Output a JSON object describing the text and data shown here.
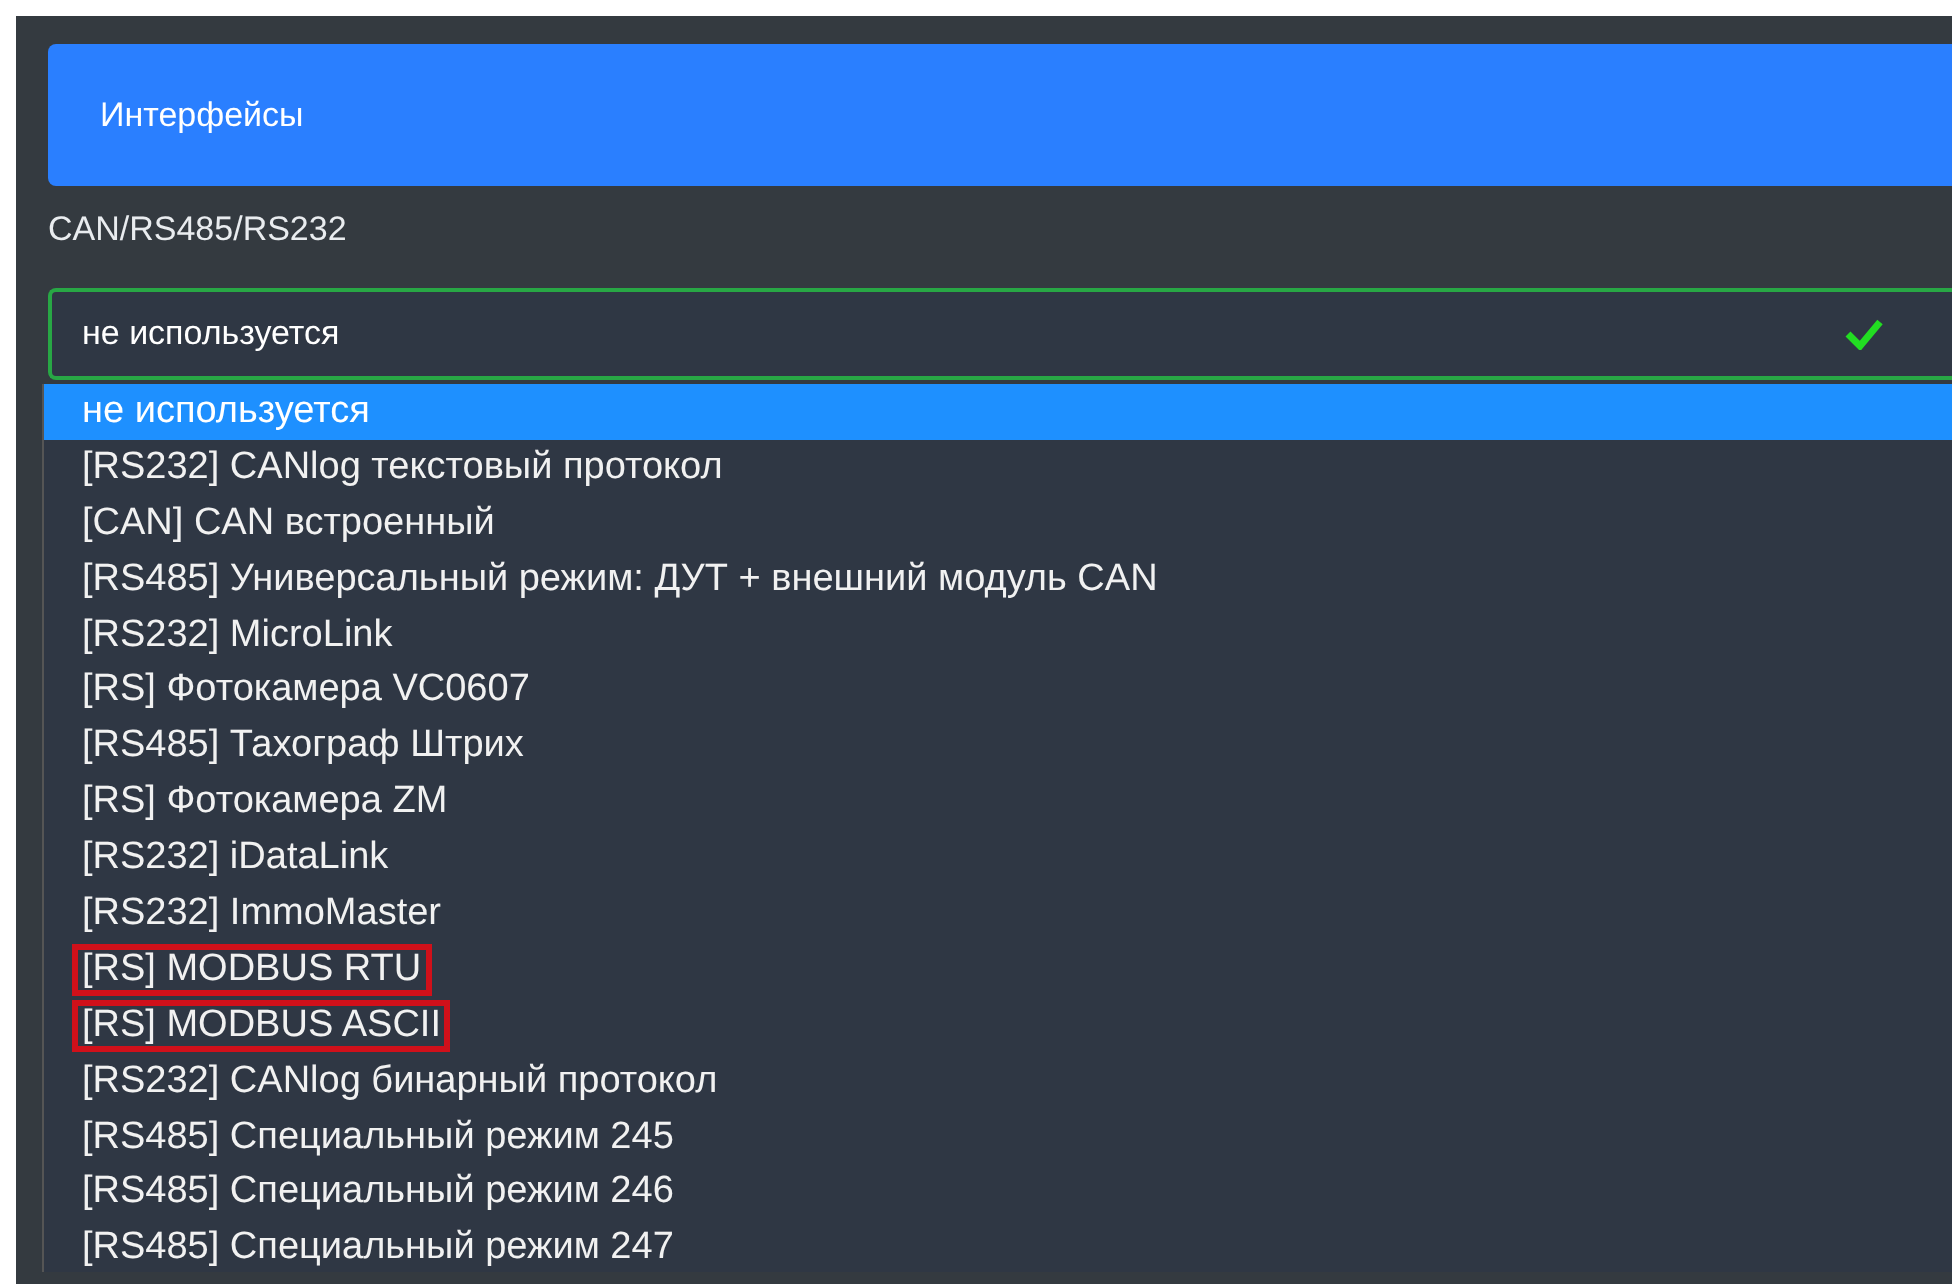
{
  "header": {
    "title": "Интерфейсы"
  },
  "field": {
    "label": "CAN/RS485/RS232",
    "value": "не используется",
    "valid": true
  },
  "dropdown": {
    "options": [
      {
        "label": "не используется",
        "selected": true,
        "highlighted": false
      },
      {
        "label": "[RS232] CANlog текстовый протокол",
        "selected": false,
        "highlighted": false
      },
      {
        "label": "[CAN] CAN встроенный",
        "selected": false,
        "highlighted": false
      },
      {
        "label": "[RS485] Универсальный режим: ДУТ + внешний модуль CAN",
        "selected": false,
        "highlighted": false
      },
      {
        "label": "[RS232] MicroLink",
        "selected": false,
        "highlighted": false
      },
      {
        "label": "[RS] Фотокамера VC0607",
        "selected": false,
        "highlighted": false
      },
      {
        "label": "[RS485] Тахограф Штрих",
        "selected": false,
        "highlighted": false
      },
      {
        "label": "[RS] Фотокамера ZM",
        "selected": false,
        "highlighted": false
      },
      {
        "label": "[RS232] iDataLink",
        "selected": false,
        "highlighted": false
      },
      {
        "label": "[RS232] ImmoMaster",
        "selected": false,
        "highlighted": false
      },
      {
        "label": "[RS] MODBUS RTU",
        "selected": false,
        "highlighted": true
      },
      {
        "label": "[RS] MODBUS ASCII",
        "selected": false,
        "highlighted": true
      },
      {
        "label": "[RS232] CANlog бинарный протокол",
        "selected": false,
        "highlighted": false
      },
      {
        "label": "[RS485] Специальный режим 245",
        "selected": false,
        "highlighted": false
      },
      {
        "label": "[RS485] Специальный режим 246",
        "selected": false,
        "highlighted": false
      },
      {
        "label": "[RS485] Специальный режим 247",
        "selected": false,
        "highlighted": false
      }
    ]
  }
}
